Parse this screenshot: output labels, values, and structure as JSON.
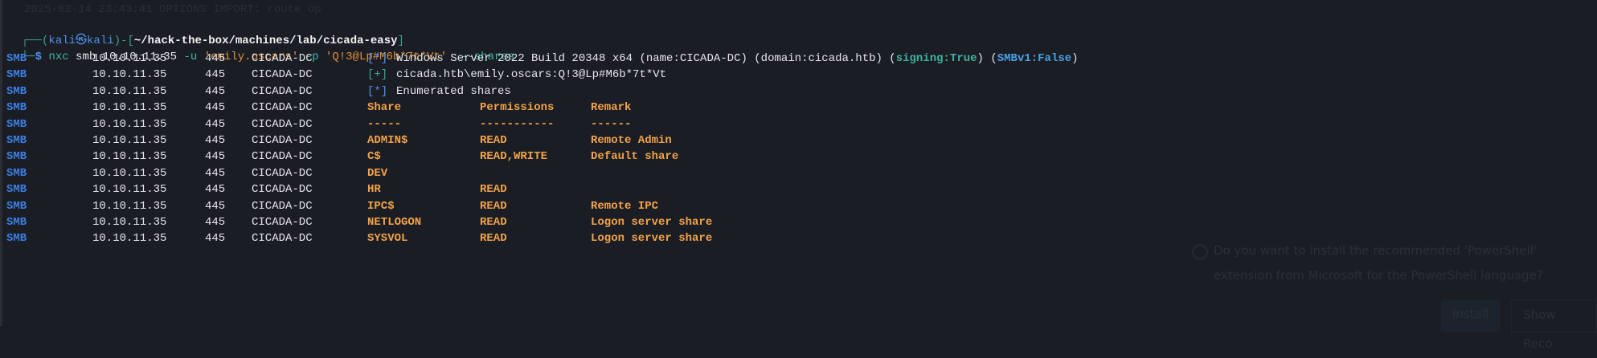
{
  "ghost_line": "2025-02-14 23:43:41 OPTIONS IMPORT: route op",
  "prompt": {
    "corner_top": "┌──(",
    "user": "kali",
    "at": "㉿",
    "host": "kali",
    "mid": ")-[",
    "path": "~/hack-the-box/machines/lab/cicada-easy",
    "close": "]",
    "corner_bottom": "└─",
    "dollar": "$ "
  },
  "command": {
    "tool": "nxc",
    "args1": " smb 10.10.11.35 ",
    "u_flag": "-u",
    "user": " 'emily.oscars' ",
    "p_flag": "-p",
    "pass": " 'Q!3@Lp#M6b*7t*Vt'",
    "shares_flag": "  --shares"
  },
  "output": {
    "proto": "SMB",
    "ip": "10.10.11.35",
    "port": "445",
    "host": "CICADA-DC",
    "info_marker": "[*]",
    "ok_marker": "[+]",
    "os_text": "Windows Server 2022 Build 20348 x64 (name:CICADA-DC) (domain:cicada.htb) (",
    "signing": "signing:True",
    "sep": ") (",
    "smbv1": "SMBv1:False",
    "close": ")",
    "auth_text": "cicada.htb\\emily.oscars:Q!3@Lp#M6b*7t*Vt",
    "enum_text": "Enumerated shares",
    "headers": [
      "Share",
      "Permissions",
      "Remark"
    ],
    "dashes": [
      "-----",
      "-----------",
      "------"
    ],
    "shares": [
      {
        "share": "ADMIN$",
        "perm": "READ",
        "remark": "Remote Admin"
      },
      {
        "share": "C$",
        "perm": "READ,WRITE",
        "remark": "Default share"
      },
      {
        "share": "DEV",
        "perm": "",
        "remark": ""
      },
      {
        "share": "HR",
        "perm": "READ",
        "remark": ""
      },
      {
        "share": "IPC$",
        "perm": "READ",
        "remark": "Remote IPC"
      },
      {
        "share": "NETLOGON",
        "perm": "READ",
        "remark": "Logon server share"
      },
      {
        "share": "SYSVOL",
        "perm": "READ",
        "remark": "Logon server share"
      }
    ]
  },
  "notification": {
    "line1": "Do you want to install the recommended 'PowerShell'",
    "line2": "extension from Microsoft for the PowerShell language?",
    "install": "Install",
    "show": "Show Reco"
  }
}
